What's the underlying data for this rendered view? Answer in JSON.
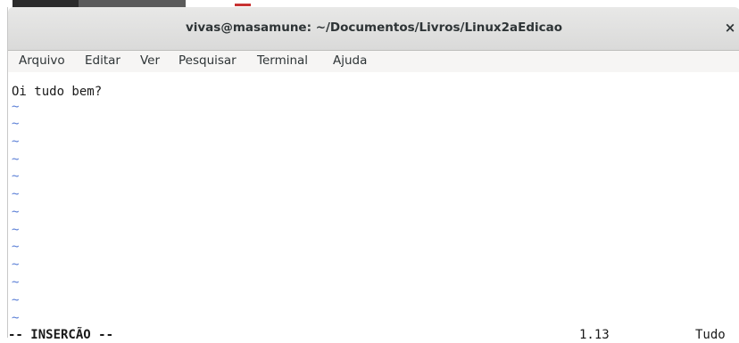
{
  "window": {
    "title": "vivas@masamune: ~/Documentos/Livros/Linux2aEdicao",
    "close_icon": "×"
  },
  "menu": [
    "Arquivo",
    "Editar",
    "Ver",
    "Pesquisar",
    "Terminal",
    "Ajuda"
  ],
  "editor": {
    "first_line": "Oi tudo bem?",
    "tilde": "~"
  },
  "status": {
    "mode": "-- INSERCÃO --",
    "position": "1.13",
    "percent": "Tudo"
  },
  "colors": {
    "tilde": "#5b7fd6",
    "titlebar": "#dadad9",
    "menubar": "#f6f5f4"
  }
}
